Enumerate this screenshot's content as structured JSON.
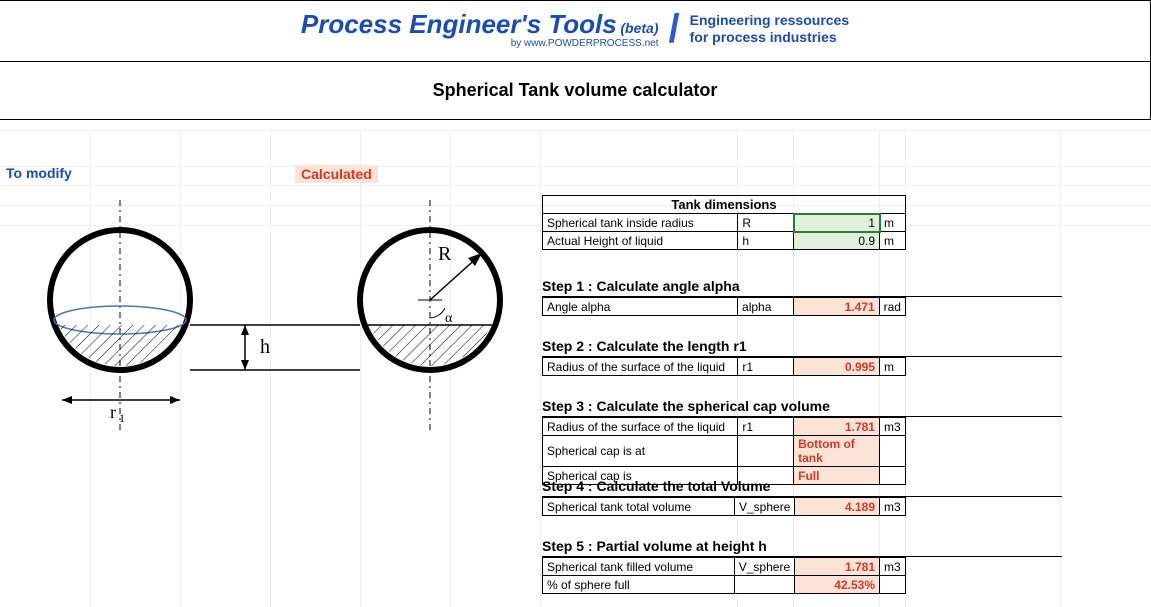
{
  "header": {
    "brand_main": "Process Engineer's Tools",
    "brand_beta": "(beta)",
    "brand_sub": "by www.POWDERPROCESS.net",
    "tagline_l1": "Engineering ressources",
    "tagline_l2": "for process industries"
  },
  "title": "Spherical Tank volume calculator",
  "legend": {
    "modify": "To modify",
    "calculated": "Calculated"
  },
  "diagram": {
    "label_r1": "r",
    "label_r1_sub": "1",
    "label_h": "h",
    "label_R": "R",
    "label_alpha": "α"
  },
  "dimensions": {
    "header": "Tank dimensions",
    "rows": [
      {
        "label": "Spherical tank inside radius",
        "sym": "R",
        "val": "1",
        "unit": "m"
      },
      {
        "label": "Actual Height of liquid",
        "sym": "h",
        "val": "0.9",
        "unit": "m"
      }
    ]
  },
  "steps": [
    {
      "title": "Step 1 : Calculate angle alpha",
      "rows": [
        {
          "label": "Angle alpha",
          "sym": "alpha",
          "val": "1.471",
          "unit": "rad",
          "kind": "num"
        }
      ]
    },
    {
      "title": "Step 2 : Calculate the length r1",
      "rows": [
        {
          "label": "Radius of the surface of the liquid",
          "sym": "r1",
          "val": "0.995",
          "unit": "m",
          "kind": "num"
        }
      ]
    },
    {
      "title": "Step 3 : Calculate the spherical cap volume",
      "rows": [
        {
          "label": "Radius of the surface of the liquid",
          "sym": "r1",
          "val": "1.781",
          "unit": "m3",
          "kind": "num"
        },
        {
          "label": "Spherical cap is at",
          "sym": "",
          "val": "Bottom of tank",
          "unit": "",
          "kind": "text"
        },
        {
          "label": "Spherical cap is",
          "sym": "",
          "val": "Full",
          "unit": "",
          "kind": "text"
        }
      ]
    },
    {
      "title": "Step 4 : Calculate the total Volume",
      "rows": [
        {
          "label": "Spherical tank total volume",
          "sym": "V_sphere",
          "val": "4.189",
          "unit": "m3",
          "kind": "num"
        }
      ]
    },
    {
      "title": "Step 5 : Partial volume at height h",
      "rows": [
        {
          "label": "Spherical tank filled volume",
          "sym": "V_sphere",
          "val": "1.781",
          "unit": "m3",
          "kind": "num"
        },
        {
          "label": "% of sphere full",
          "sym": "",
          "val": "42.53%",
          "unit": "",
          "kind": "num"
        }
      ]
    }
  ]
}
